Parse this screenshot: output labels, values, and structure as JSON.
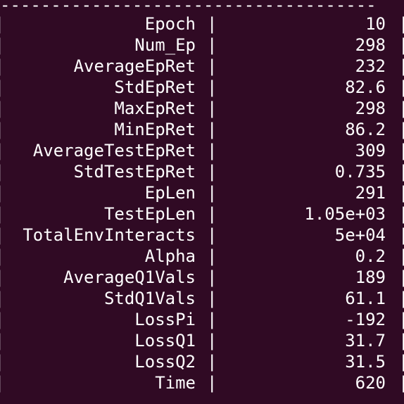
{
  "terminal": {
    "separator": "-------------------------------------",
    "divider": "|",
    "rows": [
      {
        "key": "Epoch",
        "value": "10"
      },
      {
        "key": "Num_Ep",
        "value": "298"
      },
      {
        "key": "AverageEpRet",
        "value": "232"
      },
      {
        "key": "StdEpRet",
        "value": "82.6"
      },
      {
        "key": "MaxEpRet",
        "value": "298"
      },
      {
        "key": "MinEpRet",
        "value": "86.2"
      },
      {
        "key": "AverageTestEpRet",
        "value": "309"
      },
      {
        "key": "StdTestEpRet",
        "value": "0.735"
      },
      {
        "key": "EpLen",
        "value": "291"
      },
      {
        "key": "TestEpLen",
        "value": "1.05e+03"
      },
      {
        "key": "TotalEnvInteracts",
        "value": "5e+04"
      },
      {
        "key": "Alpha",
        "value": "0.2"
      },
      {
        "key": "AverageQ1Vals",
        "value": "189"
      },
      {
        "key": "StdQ1Vals",
        "value": "61.1"
      },
      {
        "key": "LossPi",
        "value": "-192"
      },
      {
        "key": "LossQ1",
        "value": "31.7"
      },
      {
        "key": "LossQ2",
        "value": "31.5"
      },
      {
        "key": "Time",
        "value": "620"
      }
    ]
  },
  "colors": {
    "background": "#300a24",
    "foreground": "#ffffff"
  }
}
